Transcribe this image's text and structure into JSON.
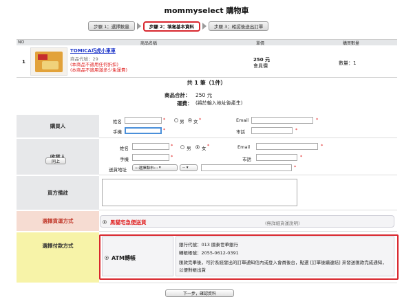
{
  "page_title": "mommyselect 購物車",
  "steps": [
    {
      "label": "步驟 1：選擇數量",
      "active": false
    },
    {
      "label": "步驟 2：填寫基本資料",
      "active": true
    },
    {
      "label": "步驟 3：確認後送出訂單",
      "active": false
    }
  ],
  "order_table": {
    "headers": [
      "NO",
      "商品名稱",
      "單價",
      "購買數量"
    ],
    "row": {
      "no": "1",
      "product_name": "TOMICA巧虎小車車",
      "product_code": "商品代號：29",
      "note1": "(本商品不適用任何折扣)",
      "note2": "(本商品不適用滿多少免運費)",
      "price": "250 元",
      "price_type": "會員價",
      "quantity": "數量：1"
    }
  },
  "summary": {
    "count": "共 1 筆（1件）",
    "total_label": "商品合計：",
    "total_value": "250 元",
    "shipping_label": "運費：",
    "shipping_value": "(將於輸入地址後產生)"
  },
  "buyer": {
    "section_label": "購買人",
    "name_label": "姓名",
    "gender_male": "男",
    "gender_female": "女",
    "email_label": "Email",
    "mobile_label": "手機",
    "phone_label": "市話"
  },
  "recipient": {
    "section_label": "收貨人",
    "same_button": "同上",
    "name_label": "姓名",
    "gender_male": "男",
    "gender_female": "女",
    "email_label": "Email",
    "mobile_label": "手機",
    "phone_label": "市話",
    "address_label": "送貨地址",
    "city_select": ":::選擇縣市:::",
    "district_select": "--"
  },
  "note": {
    "section_label": "買方備註"
  },
  "shipping_method": {
    "section_label": "選擇貨運方式",
    "option": "黑貓宅急便送貨",
    "desc": "(無詳細貨運說明)"
  },
  "payment_method": {
    "section_label": "選擇付款方式",
    "option": "ATM轉帳",
    "bank_code": "銀行代號：013 國泰世華銀行",
    "account": "轉帳帳號：2055-0612-0391",
    "instructions": "匯款完畢後，可於系統發出的訂單通知信內或登入會員後台，點選 [訂單後續連結] 來發送匯款完成通知，以便對帳出貨"
  },
  "next_button": "下一步，確認資料",
  "colors": {
    "accent_red": "#d8262d",
    "link_blue": "#1a33c9"
  }
}
